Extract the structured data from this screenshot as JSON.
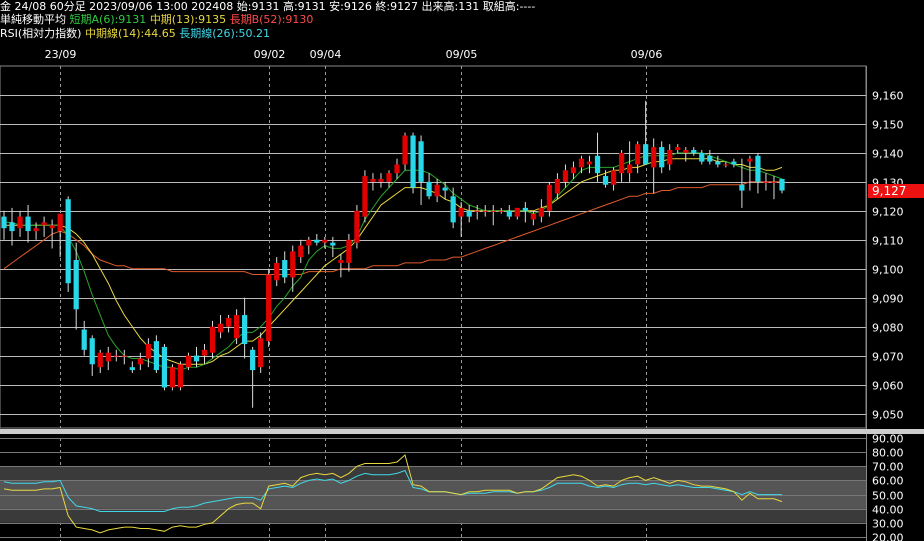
{
  "header": {
    "line1": "金 24/08 60分足 2023/09/06 13:00 202408 始:9131 高:9131 安:9126 終:9127 出来高:131 取組高:----",
    "ma_title": "単純移動平均",
    "ma_short": "短期A(6):9131",
    "ma_mid": "中期(13):9135",
    "ma_long": "長期B(52):9130",
    "rsi_title": "RSI(相対力指数)",
    "rsi_mid": "中期線(14):44.65",
    "rsi_long": "長期線(26):50.21"
  },
  "colors": {
    "up": "#e00000",
    "down": "#28d8e8",
    "ma6": "#2aa52a",
    "ma13": "#e8d840",
    "ma52": "#e05a2a",
    "rsi14": "#e8d840",
    "rsi26": "#40d8e8",
    "grid": "#ffffff",
    "bg": "#000000"
  },
  "last_price_label": "9,127",
  "chart_data": [
    {
      "type": "candlestick",
      "x_ticks": [
        "23/09",
        "09/02",
        "09/04",
        "09/05",
        "09/06"
      ],
      "ylim": [
        9045,
        9170
      ],
      "y_ticks": [
        "9,050",
        "9,060",
        "9,070",
        "9,080",
        "9,090",
        "9,100",
        "9,110",
        "9,120",
        "9,130",
        "9,140",
        "9,150",
        "9,160"
      ],
      "candles": [
        {
          "o": 9118,
          "h": 9120,
          "l": 9110,
          "c": 9114
        },
        {
          "o": 9116,
          "h": 9121,
          "l": 9108,
          "c": 9113
        },
        {
          "o": 9114,
          "h": 9120,
          "l": 9111,
          "c": 9118
        },
        {
          "o": 9118,
          "h": 9122,
          "l": 9109,
          "c": 9113
        },
        {
          "o": 9113,
          "h": 9116,
          "l": 9110,
          "c": 9114
        },
        {
          "o": 9115,
          "h": 9118,
          "l": 9111,
          "c": 9116
        },
        {
          "o": 9114,
          "h": 9117,
          "l": 9107,
          "c": 9115
        },
        {
          "o": 9113,
          "h": 9118,
          "l": 9104,
          "c": 9119
        },
        {
          "o": 9124,
          "h": 9125,
          "l": 9092,
          "c": 9095
        },
        {
          "o": 9103,
          "h": 9109,
          "l": 9079,
          "c": 9086
        },
        {
          "o": 9079,
          "h": 9082,
          "l": 9070,
          "c": 9072
        },
        {
          "o": 9076,
          "h": 9077,
          "l": 9063,
          "c": 9067
        },
        {
          "o": 9066,
          "h": 9072,
          "l": 9064,
          "c": 9071
        },
        {
          "o": 9068,
          "h": 9073,
          "l": 9065,
          "c": 9071
        },
        {
          "o": 9070,
          "h": 9072,
          "l": 9068,
          "c": 9070
        },
        {
          "o": 9070,
          "h": 9072,
          "l": 9067,
          "c": 9070
        },
        {
          "o": 9066,
          "h": 9068,
          "l": 9064,
          "c": 9065
        },
        {
          "o": 9067,
          "h": 9071,
          "l": 9065,
          "c": 9069
        },
        {
          "o": 9069,
          "h": 9076,
          "l": 9066,
          "c": 9074
        },
        {
          "o": 9075,
          "h": 9077,
          "l": 9064,
          "c": 9065
        },
        {
          "o": 9073,
          "h": 9074,
          "l": 9058,
          "c": 9059
        },
        {
          "o": 9059,
          "h": 9067,
          "l": 9058,
          "c": 9066
        },
        {
          "o": 9059,
          "h": 9068,
          "l": 9058,
          "c": 9067
        },
        {
          "o": 9066,
          "h": 9071,
          "l": 9065,
          "c": 9070
        },
        {
          "o": 9070,
          "h": 9073,
          "l": 9066,
          "c": 9068
        },
        {
          "o": 9070,
          "h": 9074,
          "l": 9067,
          "c": 9072
        },
        {
          "o": 9071,
          "h": 9082,
          "l": 9069,
          "c": 9080
        },
        {
          "o": 9078,
          "h": 9084,
          "l": 9076,
          "c": 9081
        },
        {
          "o": 9080,
          "h": 9084,
          "l": 9078,
          "c": 9083
        },
        {
          "o": 9076,
          "h": 9086,
          "l": 9074,
          "c": 9084
        },
        {
          "o": 9084,
          "h": 9090,
          "l": 9069,
          "c": 9074
        },
        {
          "o": 9072,
          "h": 9073,
          "l": 9052,
          "c": 9065
        },
        {
          "o": 9066,
          "h": 9078,
          "l": 9064,
          "c": 9076
        },
        {
          "o": 9075,
          "h": 9100,
          "l": 9073,
          "c": 9098
        },
        {
          "o": 9096,
          "h": 9104,
          "l": 9094,
          "c": 9102
        },
        {
          "o": 9103,
          "h": 9106,
          "l": 9095,
          "c": 9097
        },
        {
          "o": 9097,
          "h": 9108,
          "l": 9092,
          "c": 9106
        },
        {
          "o": 9104,
          "h": 9110,
          "l": 9102,
          "c": 9108
        },
        {
          "o": 9108,
          "h": 9111,
          "l": 9105,
          "c": 9110
        },
        {
          "o": 9110,
          "h": 9112,
          "l": 9108,
          "c": 9109
        },
        {
          "o": 9109,
          "h": 9111,
          "l": 9107,
          "c": 9110
        },
        {
          "o": 9109,
          "h": 9111,
          "l": 9104,
          "c": 9108
        },
        {
          "o": 9102,
          "h": 9105,
          "l": 9097,
          "c": 9103
        },
        {
          "o": 9102,
          "h": 9112,
          "l": 9099,
          "c": 9110
        },
        {
          "o": 9109,
          "h": 9122,
          "l": 9107,
          "c": 9120
        },
        {
          "o": 9118,
          "h": 9134,
          "l": 9116,
          "c": 9132
        },
        {
          "o": 9130,
          "h": 9133,
          "l": 9127,
          "c": 9131
        },
        {
          "o": 9130,
          "h": 9133,
          "l": 9128,
          "c": 9131
        },
        {
          "o": 9130,
          "h": 9134,
          "l": 9128,
          "c": 9133
        },
        {
          "o": 9133,
          "h": 9138,
          "l": 9131,
          "c": 9136
        },
        {
          "o": 9136,
          "h": 9147,
          "l": 9134,
          "c": 9146
        },
        {
          "o": 9146,
          "h": 9147,
          "l": 9126,
          "c": 9128
        },
        {
          "o": 9144,
          "h": 9146,
          "l": 9122,
          "c": 9130
        },
        {
          "o": 9130,
          "h": 9133,
          "l": 9124,
          "c": 9125
        },
        {
          "o": 9125,
          "h": 9131,
          "l": 9123,
          "c": 9129
        },
        {
          "o": 9128,
          "h": 9130,
          "l": 9124,
          "c": 9127
        },
        {
          "o": 9125,
          "h": 9128,
          "l": 9114,
          "c": 9116
        },
        {
          "o": 9118,
          "h": 9123,
          "l": 9111,
          "c": 9121
        },
        {
          "o": 9120,
          "h": 9122,
          "l": 9116,
          "c": 9118
        },
        {
          "o": 9120,
          "h": 9122,
          "l": 9117,
          "c": 9120
        },
        {
          "o": 9120,
          "h": 9122,
          "l": 9118,
          "c": 9120
        },
        {
          "o": 9120,
          "h": 9122,
          "l": 9115,
          "c": 9120
        },
        {
          "o": 9120,
          "h": 9121,
          "l": 9119,
          "c": 9120
        },
        {
          "o": 9120,
          "h": 9122,
          "l": 9117,
          "c": 9118
        },
        {
          "o": 9118,
          "h": 9121,
          "l": 9117,
          "c": 9121
        },
        {
          "o": 9121,
          "h": 9123,
          "l": 9116,
          "c": 9120
        },
        {
          "o": 9117,
          "h": 9120,
          "l": 9115,
          "c": 9119
        },
        {
          "o": 9118,
          "h": 9124,
          "l": 9116,
          "c": 9121
        },
        {
          "o": 9120,
          "h": 9130,
          "l": 9118,
          "c": 9129
        },
        {
          "o": 9126,
          "h": 9133,
          "l": 9124,
          "c": 9131
        },
        {
          "o": 9130,
          "h": 9136,
          "l": 9128,
          "c": 9134
        },
        {
          "o": 9133,
          "h": 9137,
          "l": 9131,
          "c": 9135
        },
        {
          "o": 9135,
          "h": 9139,
          "l": 9133,
          "c": 9138
        },
        {
          "o": 9136,
          "h": 9139,
          "l": 9133,
          "c": 9137
        },
        {
          "o": 9139,
          "h": 9147,
          "l": 9130,
          "c": 9133
        },
        {
          "o": 9132,
          "h": 9134,
          "l": 9128,
          "c": 9129
        },
        {
          "o": 9129,
          "h": 9135,
          "l": 9127,
          "c": 9134
        },
        {
          "o": 9133,
          "h": 9141,
          "l": 9130,
          "c": 9140
        },
        {
          "o": 9133,
          "h": 9144,
          "l": 9130,
          "c": 9136
        },
        {
          "o": 9136,
          "h": 9144,
          "l": 9133,
          "c": 9143
        },
        {
          "o": 9143,
          "h": 9158,
          "l": 9136,
          "c": 9136
        },
        {
          "o": 9135,
          "h": 9145,
          "l": 9126,
          "c": 9142
        },
        {
          "o": 9142,
          "h": 9144,
          "l": 9133,
          "c": 9135
        },
        {
          "o": 9136,
          "h": 9143,
          "l": 9134,
          "c": 9141
        },
        {
          "o": 9141,
          "h": 9143,
          "l": 9140,
          "c": 9142
        },
        {
          "o": 9140,
          "h": 9142,
          "l": 9137,
          "c": 9141
        },
        {
          "o": 9141,
          "h": 9142,
          "l": 9139,
          "c": 9140
        },
        {
          "o": 9140,
          "h": 9141,
          "l": 9136,
          "c": 9137
        },
        {
          "o": 9139,
          "h": 9141,
          "l": 9136,
          "c": 9137
        },
        {
          "o": 9137,
          "h": 9139,
          "l": 9135,
          "c": 9136
        },
        {
          "o": 9136,
          "h": 9137,
          "l": 9135,
          "c": 9136
        },
        {
          "o": 9137,
          "h": 9138,
          "l": 9135,
          "c": 9136
        },
        {
          "o": 9129,
          "h": 9138,
          "l": 9121,
          "c": 9127
        },
        {
          "o": 9137,
          "h": 9139,
          "l": 9127,
          "c": 9138
        },
        {
          "o": 9139,
          "h": 9140,
          "l": 9126,
          "c": 9130
        },
        {
          "o": 9130,
          "h": 9133,
          "l": 9127,
          "c": 9130
        },
        {
          "o": 9130,
          "h": 9132,
          "l": 9124,
          "c": 9130
        },
        {
          "o": 9131,
          "h": 9131,
          "l": 9126,
          "c": 9127
        }
      ],
      "x_tick_candle_index": [
        7,
        33,
        40,
        57,
        80
      ],
      "ma6": [
        9116,
        9116,
        9115,
        9115,
        9115,
        9115,
        9115,
        9115,
        9111,
        9106,
        9099,
        9091,
        9084,
        9077,
        9073,
        9070,
        9069,
        9069,
        9068,
        9067,
        9066,
        9066,
        9065,
        9066,
        9066,
        9067,
        9069,
        9071,
        9073,
        9076,
        9078,
        9078,
        9080,
        9083,
        9087,
        9090,
        9094,
        9097,
        9103,
        9106,
        9108,
        9107,
        9107,
        9108,
        9111,
        9117,
        9121,
        9125,
        9128,
        9131,
        9134,
        9134,
        9134,
        9133,
        9131,
        9129,
        9126,
        9124,
        9122,
        9121,
        9120,
        9120,
        9120,
        9120,
        9120,
        9120,
        9119,
        9120,
        9122,
        9125,
        9128,
        9131,
        9134,
        9135,
        9135,
        9135,
        9135,
        9136,
        9137,
        9138,
        9139,
        9139,
        9139,
        9139,
        9140,
        9140,
        9140,
        9140,
        9139,
        9138,
        9137,
        9136,
        9135,
        9134,
        9134,
        9133,
        9132,
        9131
      ],
      "ma13": [
        9115,
        9115,
        9115,
        9115,
        9115,
        9115,
        9115,
        9115,
        9114,
        9112,
        9109,
        9105,
        9100,
        9095,
        9089,
        9084,
        9080,
        9076,
        9073,
        9071,
        9069,
        9068,
        9067,
        9067,
        9067,
        9067,
        9068,
        9070,
        9071,
        9073,
        9075,
        9075,
        9077,
        9080,
        9083,
        9086,
        9089,
        9092,
        9095,
        9098,
        9101,
        9103,
        9105,
        9107,
        9110,
        9114,
        9118,
        9122,
        9124,
        9126,
        9128,
        9128,
        9128,
        9127,
        9126,
        9124,
        9123,
        9121,
        9120,
        9120,
        9120,
        9120,
        9120,
        9120,
        9120,
        9120,
        9120,
        9121,
        9122,
        9124,
        9126,
        9128,
        9130,
        9131,
        9132,
        9133,
        9134,
        9134,
        9135,
        9135,
        9136,
        9137,
        9137,
        9138,
        9138,
        9138,
        9138,
        9138,
        9138,
        9137,
        9137,
        9136,
        9136,
        9135,
        9135,
        9134,
        9134,
        9135
      ],
      "ma52": [
        9100,
        9102,
        9104,
        9106,
        9108,
        9110,
        9112,
        9113,
        9112,
        9110,
        9108,
        9105,
        9103,
        9102,
        9101,
        9101,
        9100,
        9100,
        9100,
        9100,
        9100,
        9099,
        9099,
        9099,
        9099,
        9099,
        9099,
        9099,
        9099,
        9099,
        9099,
        9098,
        9098,
        9098,
        9098,
        9098,
        9098,
        9098,
        9099,
        9099,
        9099,
        9099,
        9100,
        9100,
        9100,
        9100,
        9101,
        9101,
        9101,
        9101,
        9102,
        9102,
        9102,
        9103,
        9103,
        9103,
        9104,
        9104,
        9105,
        9106,
        9107,
        9108,
        9109,
        9110,
        9111,
        9112,
        9113,
        9114,
        9115,
        9116,
        9117,
        9118,
        9119,
        9120,
        9121,
        9122,
        9123,
        9124,
        9125,
        9125,
        9126,
        9126,
        9127,
        9127,
        9128,
        9128,
        9128,
        9128,
        9129,
        9129,
        9129,
        9129,
        9129,
        9130,
        9130,
        9130,
        9130,
        9130
      ]
    },
    {
      "type": "line",
      "ylim": [
        20,
        90
      ],
      "y_ticks": [
        "20.00",
        "30.00",
        "40.00",
        "50.00",
        "60.00",
        "70.00",
        "80.00",
        "90.00"
      ],
      "series": [
        {
          "name": "中期線(14)",
          "values": [
            54,
            53,
            53,
            53,
            53,
            54,
            54,
            55,
            35,
            27,
            26,
            25,
            23,
            25,
            26,
            27,
            27,
            26,
            26,
            25,
            24,
            27,
            28,
            27,
            27,
            29,
            30,
            35,
            40,
            43,
            44,
            44,
            40,
            56,
            57,
            58,
            56,
            62,
            64,
            65,
            64,
            65,
            62,
            65,
            70,
            72,
            72,
            72,
            72,
            73,
            78,
            57,
            56,
            52,
            52,
            52,
            51,
            50,
            52,
            52,
            53,
            53,
            53,
            53,
            51,
            52,
            52,
            54,
            58,
            62,
            63,
            64,
            63,
            60,
            56,
            57,
            56,
            60,
            62,
            63,
            60,
            62,
            60,
            58,
            60,
            59,
            57,
            56,
            56,
            55,
            54,
            52,
            46,
            51,
            47,
            47,
            47,
            45
          ]
        },
        {
          "name": "長期線(26)",
          "values": [
            59,
            58,
            58,
            58,
            58,
            59,
            59,
            60,
            48,
            42,
            41,
            40,
            38,
            38,
            38,
            38,
            38,
            38,
            38,
            38,
            38,
            40,
            41,
            41,
            42,
            44,
            45,
            46,
            47,
            48,
            48,
            48,
            46,
            54,
            55,
            56,
            55,
            58,
            60,
            61,
            60,
            61,
            58,
            60,
            63,
            65,
            64,
            64,
            64,
            65,
            67,
            55,
            54,
            52,
            52,
            52,
            51,
            50,
            51,
            51,
            51,
            52,
            52,
            52,
            51,
            52,
            52,
            53,
            55,
            58,
            58,
            58,
            58,
            56,
            55,
            56,
            55,
            57,
            58,
            58,
            57,
            58,
            57,
            56,
            57,
            56,
            55,
            55,
            55,
            54,
            53,
            52,
            50,
            52,
            50,
            50,
            50,
            50
          ]
        }
      ]
    }
  ]
}
